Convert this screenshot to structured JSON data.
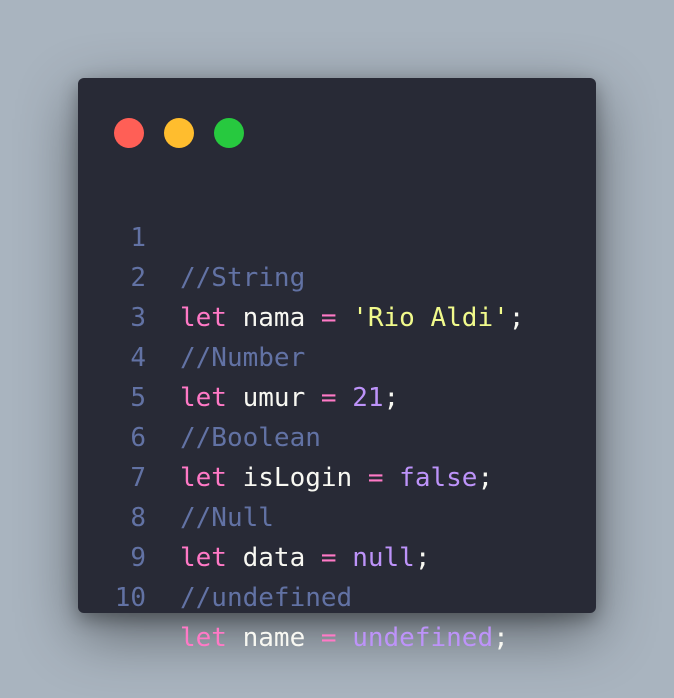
{
  "window": {
    "controls": {
      "close_color": "#ff5f56",
      "minimize_color": "#ffbd2e",
      "maximize_color": "#27c93f"
    }
  },
  "theme": {
    "background": "#282a36",
    "comment": "#6272a4",
    "keyword": "#ff79c6",
    "string": "#f1fa8c",
    "constant": "#bd93f9",
    "text": "#f8f8f2"
  },
  "code": {
    "lines": [
      {
        "number": "1",
        "comment": "//String"
      },
      {
        "number": "2",
        "keyword": "let",
        "identifier": "nama",
        "operator": "=",
        "value": "'Rio Aldi'",
        "value_type": "string",
        "terminator": ";"
      },
      {
        "number": "3",
        "comment": "//Number"
      },
      {
        "number": "4",
        "keyword": "let",
        "identifier": "umur",
        "operator": "=",
        "value": "21",
        "value_type": "constant",
        "terminator": ";"
      },
      {
        "number": "5",
        "comment": "//Boolean"
      },
      {
        "number": "6",
        "keyword": "let",
        "identifier": "isLogin",
        "operator": "=",
        "value": "false",
        "value_type": "constant",
        "terminator": ";"
      },
      {
        "number": "7",
        "comment": "//Null"
      },
      {
        "number": "8",
        "keyword": "let",
        "identifier": "data",
        "operator": "=",
        "value": "null",
        "value_type": "constant",
        "terminator": ";"
      },
      {
        "number": "9",
        "comment": "//undefined"
      },
      {
        "number": "10",
        "keyword": "let",
        "identifier": "name",
        "operator": "=",
        "value": "undefined",
        "value_type": "constant",
        "terminator": ";"
      }
    ]
  }
}
